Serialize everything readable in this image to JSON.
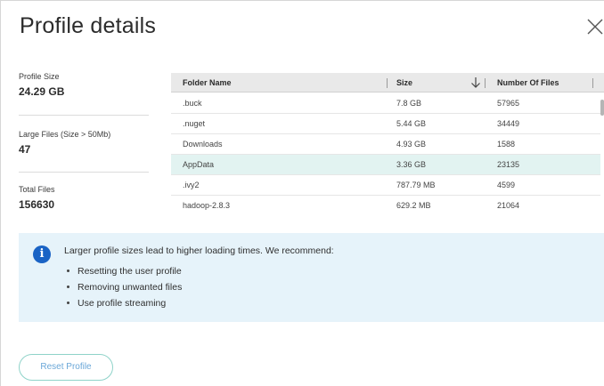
{
  "dialog": {
    "title": "Profile details"
  },
  "stats": [
    {
      "label": "Profile Size",
      "value": "24.29 GB"
    },
    {
      "label": "Large Files (Size > 50Mb)",
      "value": "47"
    },
    {
      "label": "Total Files",
      "value": "156630"
    }
  ],
  "table": {
    "columns": [
      "Folder Name",
      "Size",
      "Number Of Files"
    ],
    "sort_icon": "arrow-down-icon",
    "rows": [
      {
        "name": ".buck",
        "size": "7.8 GB",
        "files": "57965",
        "selected": false
      },
      {
        "name": ".nuget",
        "size": "5.44 GB",
        "files": "34449",
        "selected": false
      },
      {
        "name": "Downloads",
        "size": "4.93 GB",
        "files": "1588",
        "selected": false
      },
      {
        "name": "AppData",
        "size": "3.36 GB",
        "files": "23135",
        "selected": true
      },
      {
        "name": ".ivy2",
        "size": "787.79 MB",
        "files": "4599",
        "selected": false
      },
      {
        "name": "hadoop-2.8.3",
        "size": "629.2 MB",
        "files": "21064",
        "selected": false
      }
    ]
  },
  "info": {
    "icon": "info-icon",
    "text": "Larger profile sizes lead to higher loading times. We recommend:",
    "items": [
      "Resetting the user profile",
      "Removing unwanted files",
      "Use profile streaming"
    ]
  },
  "actions": {
    "reset_label": "Reset Profile"
  },
  "colors": {
    "accent_blue": "#1a63c5",
    "selected_row": "#e2f3f1",
    "info_background": "#e6f3fa",
    "button_border": "#8fd3c9",
    "button_text": "#6aa7d8"
  }
}
